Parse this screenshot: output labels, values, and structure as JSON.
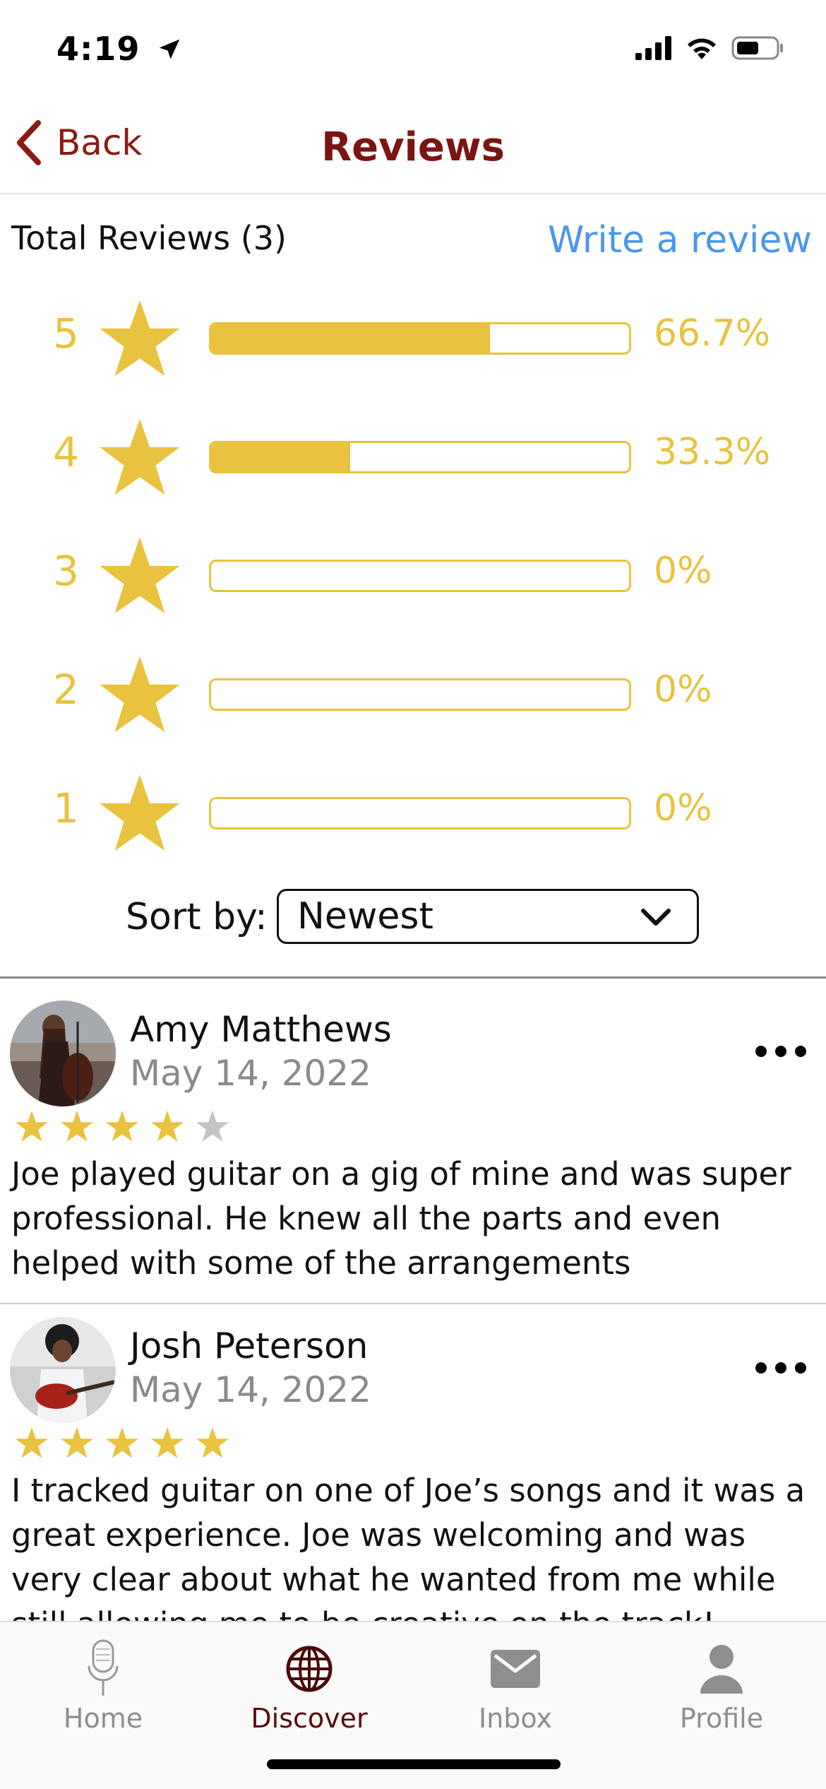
{
  "status_bar": {
    "time": "4:19"
  },
  "header": {
    "back_label": "Back",
    "title": "Reviews"
  },
  "summary": {
    "total_label": "Total Reviews (3)",
    "write_review": "Write a review",
    "rows": [
      {
        "stars": "5",
        "fraction": 0.667,
        "percent": "66.7%"
      },
      {
        "stars": "4",
        "fraction": 0.333,
        "percent": "33.3%"
      },
      {
        "stars": "3",
        "fraction": 0,
        "percent": "0%"
      },
      {
        "stars": "2",
        "fraction": 0,
        "percent": "0%"
      },
      {
        "stars": "1",
        "fraction": 0,
        "percent": "0%"
      }
    ]
  },
  "sort": {
    "label": "Sort by:",
    "selected": "Newest"
  },
  "reviews": [
    {
      "name": "Amy Matthews",
      "date": "May 14, 2022",
      "rating": 4,
      "text": "Joe played guitar on a gig of mine and was super professional. He knew all the parts and even helped with some of the arrangements"
    },
    {
      "name": "Josh Peterson",
      "date": "May 14, 2022",
      "rating": 5,
      "text": "I tracked guitar on one of Joe’s songs and it was a great experience. Joe was welcoming and was very clear about what he wanted from me while still allowing me to be creative on the track!"
    }
  ],
  "tabs": [
    {
      "label": "Home",
      "icon": "microphone-icon"
    },
    {
      "label": "Discover",
      "icon": "globe-icon",
      "active": true
    },
    {
      "label": "Inbox",
      "icon": "envelope-icon"
    },
    {
      "label": "Profile",
      "icon": "person-icon"
    }
  ],
  "colors": {
    "accent_gold": "#e9c33f",
    "title_maroon": "#7a1512",
    "link_blue": "#4a97ea",
    "inactive_gray": "#8e8e8e"
  }
}
